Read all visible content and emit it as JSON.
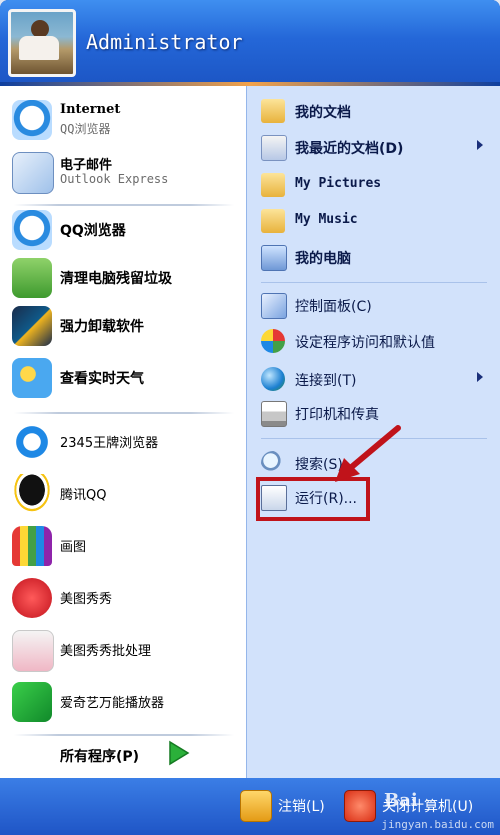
{
  "user": {
    "name": "Administrator"
  },
  "left_pinned": [
    {
      "title": "Internet",
      "subtitle": "QQ浏览器",
      "icon": "qq-browser-icon"
    },
    {
      "title": "电子邮件",
      "subtitle": "Outlook Express",
      "icon": "mail-icon"
    }
  ],
  "left_recent_top": [
    {
      "label": "QQ浏览器",
      "icon": "qq-browser-icon"
    },
    {
      "label": "清理电脑残留垃圾",
      "icon": "recycle-bin-icon"
    },
    {
      "label": "强力卸载软件",
      "icon": "uninstall-icon"
    },
    {
      "label": "查看实时天气",
      "icon": "weather-icon"
    }
  ],
  "left_recent_bottom": [
    {
      "label": "2345王牌浏览器",
      "icon": "ie-browser-icon"
    },
    {
      "label": "腾讯QQ",
      "icon": "qq-penguin-icon"
    },
    {
      "label": "画图",
      "icon": "paint-icon"
    },
    {
      "label": "美图秀秀",
      "icon": "meitu-icon"
    },
    {
      "label": "美图秀秀批处理",
      "icon": "meitu-batch-icon"
    },
    {
      "label": "爱奇艺万能播放器",
      "icon": "iqiyi-player-icon"
    }
  ],
  "all_programs": "所有程序(P)",
  "right_group1": [
    {
      "label": "我的文档",
      "icon": "documents-folder-icon",
      "submenu": false
    },
    {
      "label": "我最近的文档(D)",
      "icon": "recent-docs-icon",
      "submenu": true
    },
    {
      "label": "My Pictures",
      "icon": "pictures-folder-icon",
      "submenu": false
    },
    {
      "label": "My Music",
      "icon": "music-folder-icon",
      "submenu": false
    },
    {
      "label": "我的电脑",
      "icon": "computer-icon",
      "submenu": false
    }
  ],
  "right_group2": [
    {
      "label": "控制面板(C)",
      "icon": "control-panel-icon",
      "submenu": false
    },
    {
      "label": "设定程序访问和默认值",
      "icon": "program-defaults-icon",
      "submenu": false
    },
    {
      "label": "连接到(T)",
      "icon": "network-globe-icon",
      "submenu": true
    },
    {
      "label": "打印机和传真",
      "icon": "printer-icon",
      "submenu": false
    }
  ],
  "right_group3": [
    {
      "label": "搜索(S)",
      "icon": "search-icon",
      "submenu": false
    },
    {
      "label": "运行(R)...",
      "icon": "run-icon",
      "submenu": false
    }
  ],
  "footer": {
    "logoff": "注销(L)",
    "shutdown": "关闭计算机(U)"
  },
  "watermark": {
    "logo": "Bai",
    "site": "jingyan.baidu.com"
  },
  "colors": {
    "accent_red": "#c0131a",
    "header_blue": "#2467d8",
    "right_pane": "#d2e2fb"
  }
}
